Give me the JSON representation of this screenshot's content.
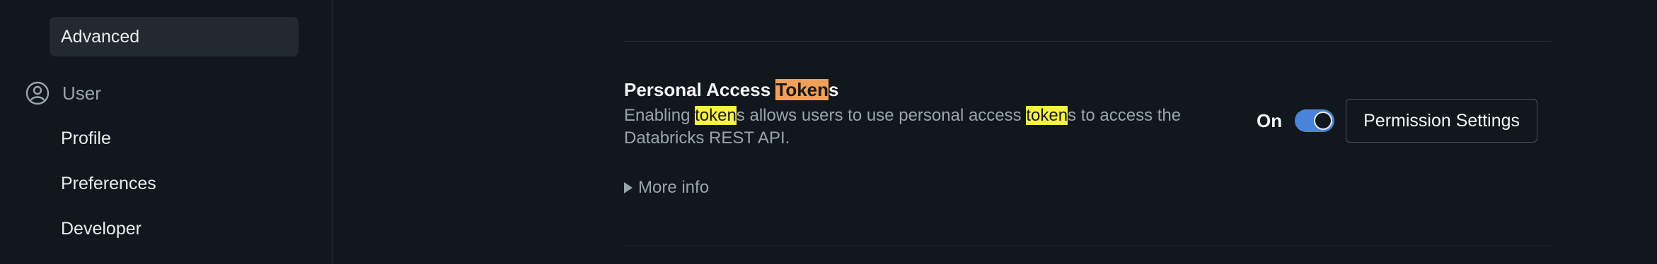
{
  "sidebar": {
    "active_item": "Advanced",
    "section_label": "User",
    "section_icon": "user-circle-icon",
    "items": [
      "Profile",
      "Preferences",
      "Developer"
    ]
  },
  "setting": {
    "title_prefix": "Personal Access ",
    "title_highlight": "Token",
    "title_suffix": "s",
    "desc_part1": "Enabling ",
    "desc_hl1": "token",
    "desc_part2": "s allows users to use personal access ",
    "desc_hl2": "token",
    "desc_part3": "s to access the Databricks REST API.",
    "more_info": "More info",
    "state_label": "On",
    "enabled": true,
    "permission_button": "Permission Settings"
  },
  "colors": {
    "background": "#11171c",
    "toggle_on": "#4a84d8",
    "highlight_current": "#f0a05a",
    "highlight_match": "#f6f246"
  }
}
